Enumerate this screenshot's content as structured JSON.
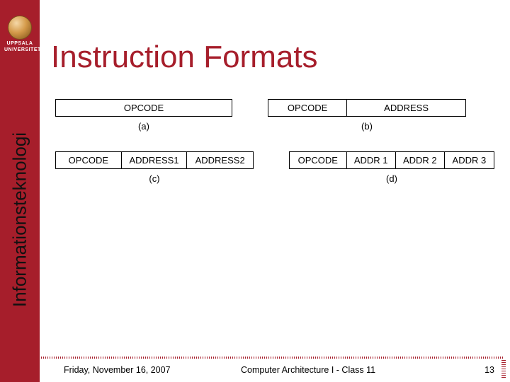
{
  "brand": {
    "university_line1": "UPPSALA",
    "university_line2": "UNIVERSITET",
    "department": "Informationsteknologi"
  },
  "title": "Instruction Formats",
  "formats": {
    "a": {
      "cells": [
        "OPCODE"
      ],
      "caption": "(a)"
    },
    "b": {
      "cells": [
        "OPCODE",
        "ADDRESS"
      ],
      "caption": "(b)"
    },
    "c": {
      "cells": [
        "OPCODE",
        "ADDRESS1",
        "ADDRESS2"
      ],
      "caption": "(c)"
    },
    "d": {
      "cells": [
        "OPCODE",
        "ADDR 1",
        "ADDR 2",
        "ADDR 3"
      ],
      "caption": "(d)"
    }
  },
  "footer": {
    "date": "Friday, November 16, 2007",
    "course": "Computer Architecture I - Class 11",
    "page": "13"
  },
  "colors": {
    "brand_red": "#a61e2b"
  }
}
